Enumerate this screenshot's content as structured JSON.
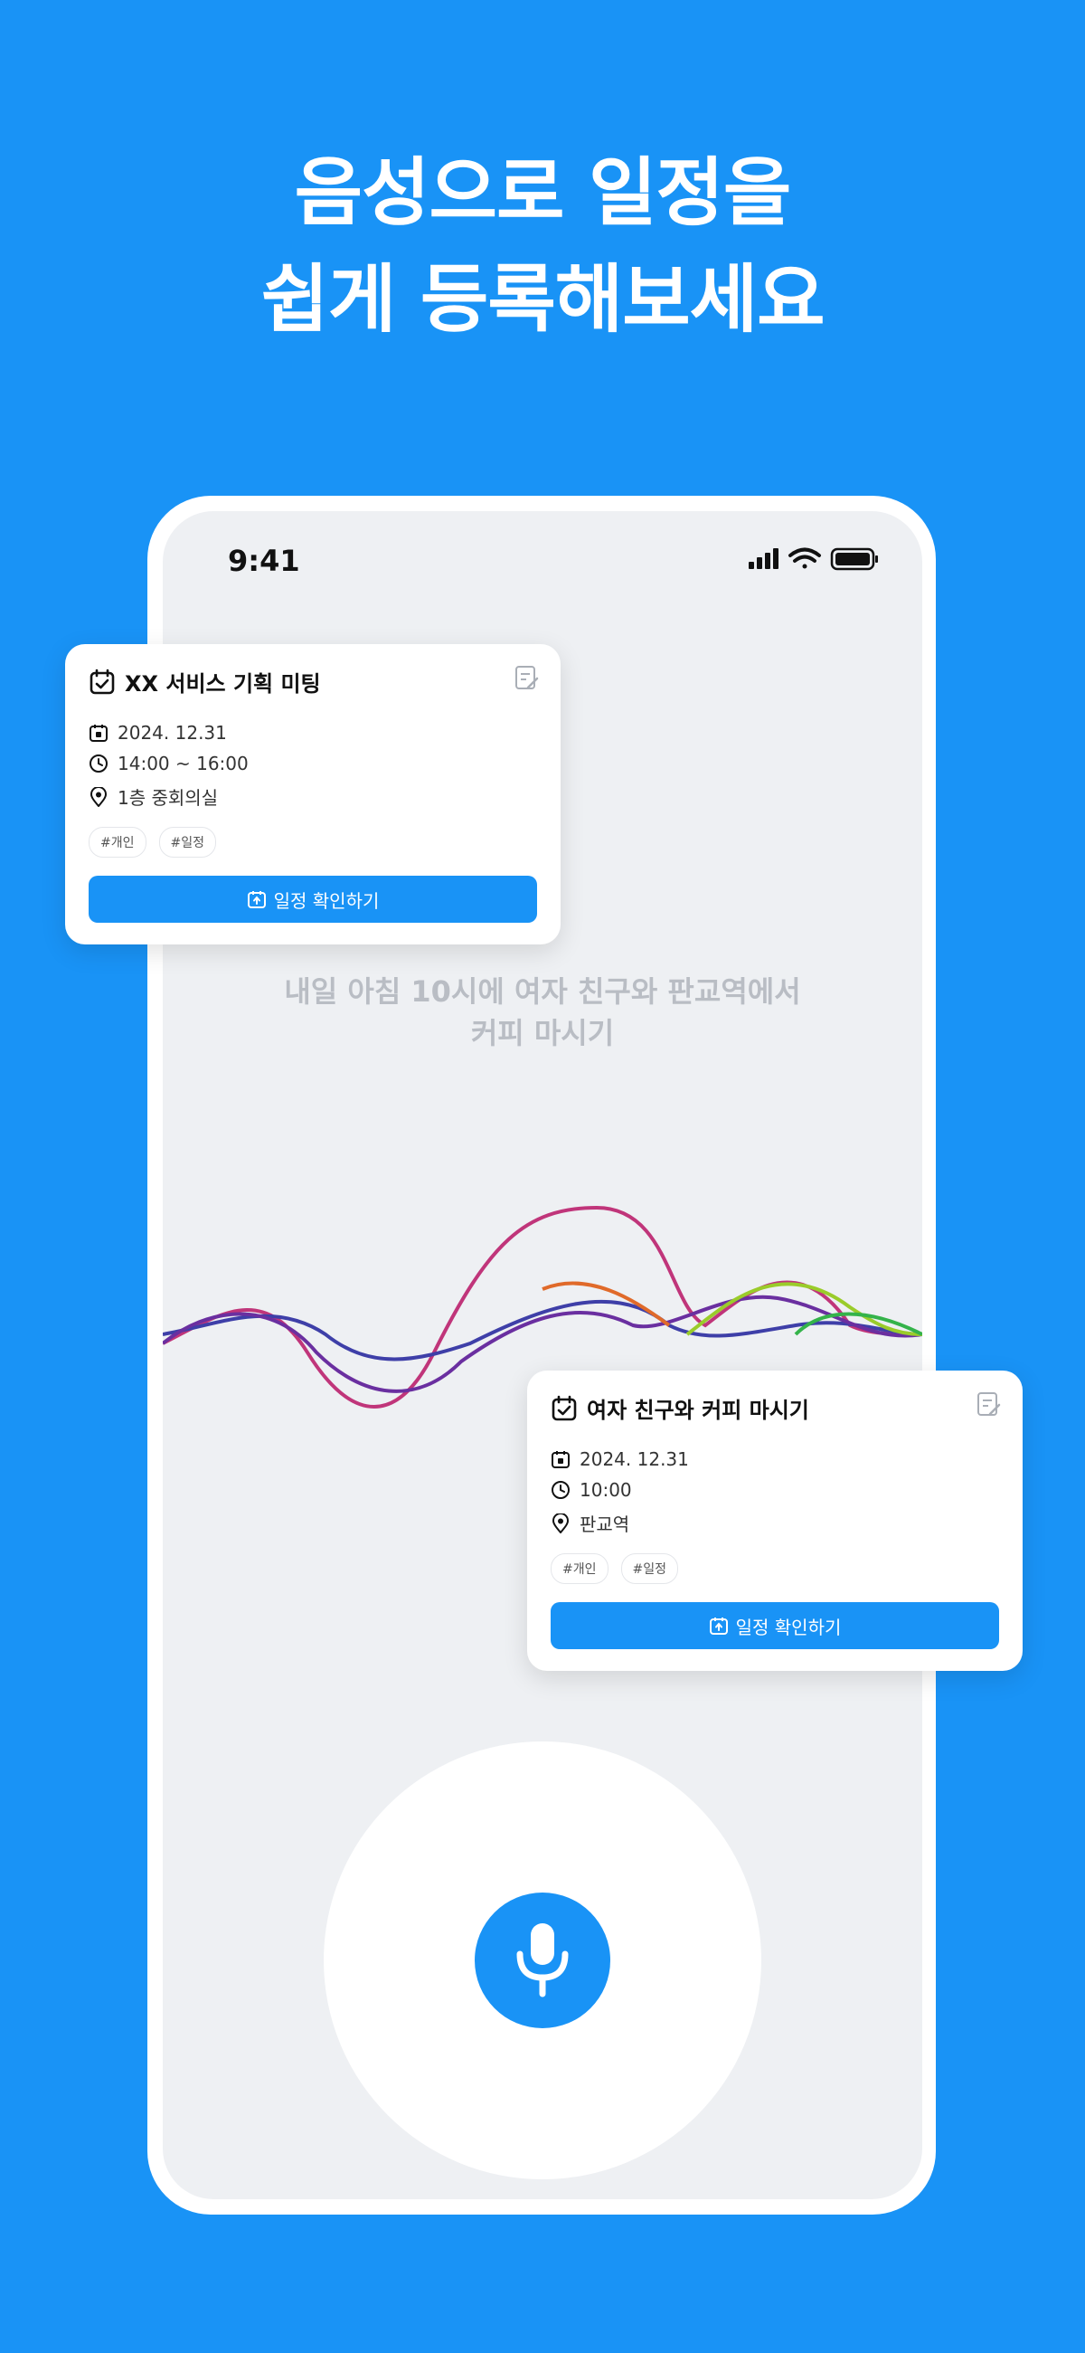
{
  "headline": {
    "line1": "음성으로 일정을",
    "line2": "쉽게 등록해보세요"
  },
  "status_bar": {
    "time": "9:41"
  },
  "transcript": {
    "line1": "내일 아침 10시에 여자 친구와 판교역에서",
    "line2": "커피 마시기"
  },
  "cards": [
    {
      "title": "XX 서비스 기획 미팅",
      "date": "2024. 12.31",
      "time": "14:00 ~ 16:00",
      "location": "1층 중회의실",
      "tags": [
        "#개인",
        "#일정"
      ],
      "button": "일정 확인하기"
    },
    {
      "title": "여자 친구와 커피 마시기",
      "date": "2024. 12.31",
      "time": "10:00",
      "location": "판교역",
      "tags": [
        "#개인",
        "#일정"
      ],
      "button": "일정 확인하기"
    }
  ],
  "icons": {
    "calendar": "calendar-check-icon",
    "date": "calendar-icon",
    "time": "clock-icon",
    "location": "location-pin-icon",
    "edit": "edit-note-icon",
    "mic": "microphone-icon"
  },
  "colors": {
    "brand": "#1993F6",
    "screen_bg": "#EEF0F3"
  }
}
